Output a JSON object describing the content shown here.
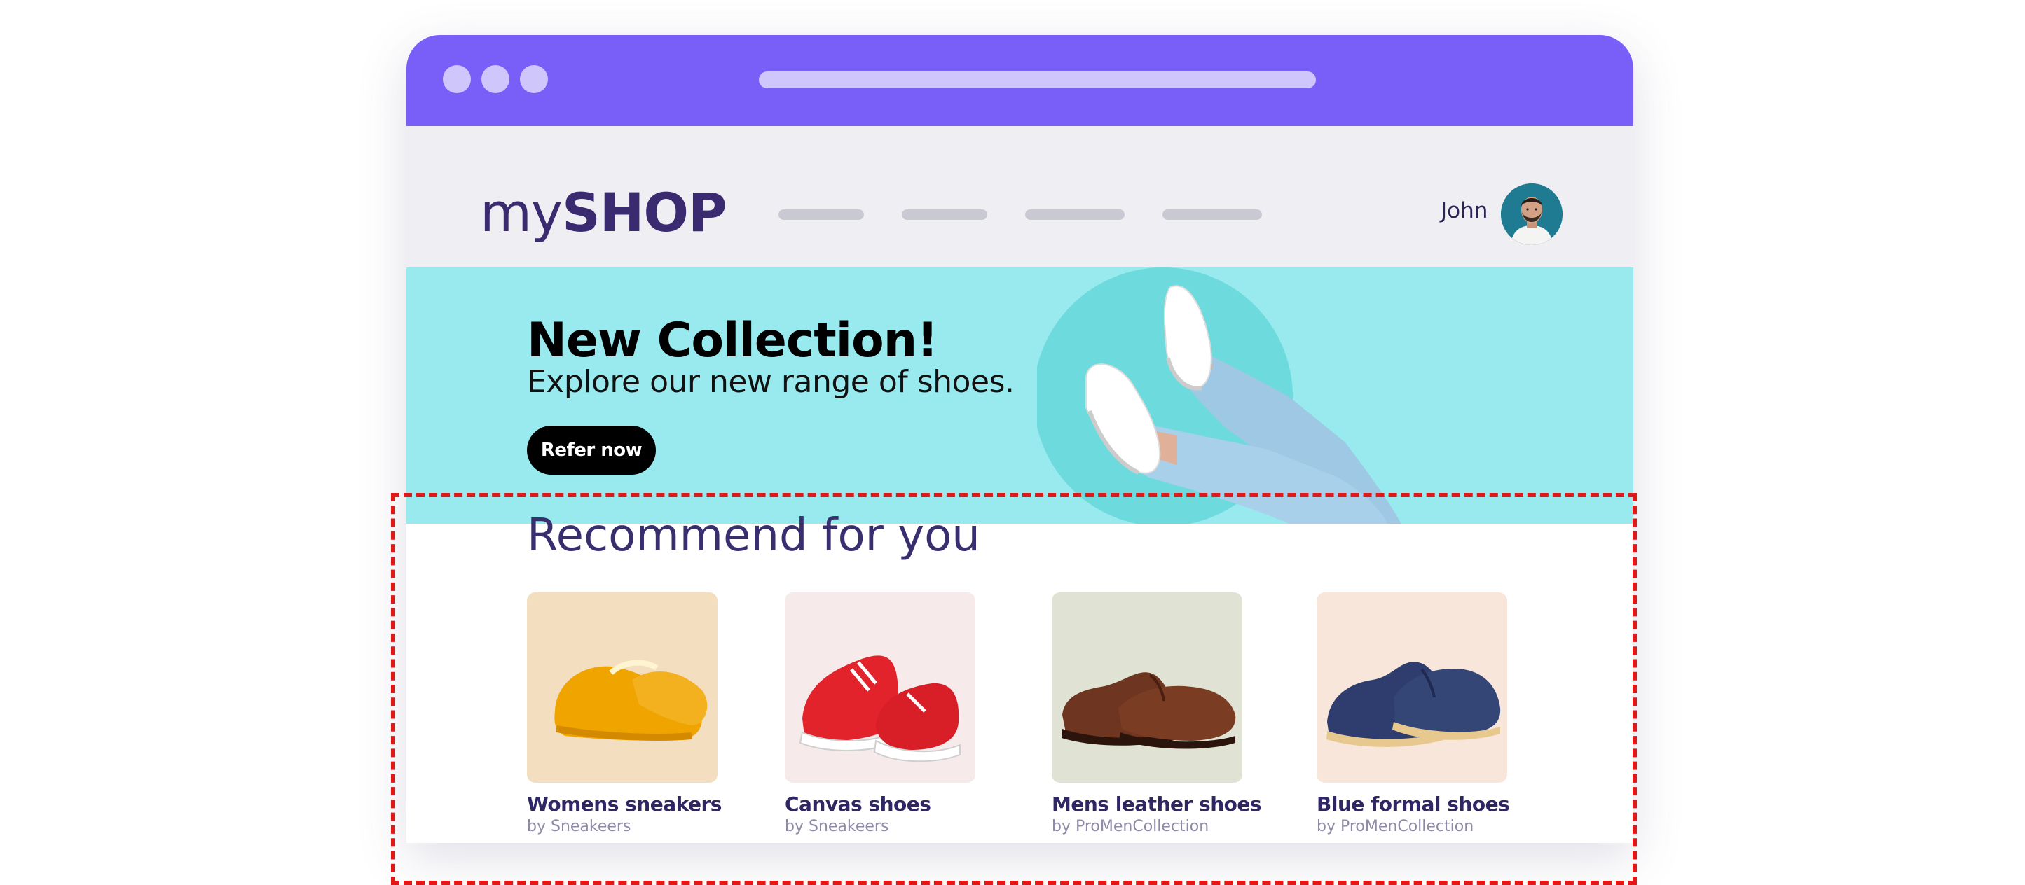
{
  "colors": {
    "titlebar": "#795ef8",
    "nav_bg": "#eeeef3",
    "hero_bg": "#98eaee",
    "accent_text": "#3a2a70",
    "highlight_border": "#e01818"
  },
  "browser": {
    "window_controls": [
      "dot",
      "dot",
      "dot"
    ]
  },
  "header": {
    "logo_light": "my",
    "logo_bold": "SHOP",
    "nav_links": [
      "",
      "",
      "",
      ""
    ],
    "user_name": "John",
    "avatar_icon": "user-avatar"
  },
  "hero": {
    "title": "New Collection!",
    "subtitle": "Explore our new range of shoes.",
    "button_label": "Refer now"
  },
  "recommendations": {
    "title": "Recommend for you",
    "products": [
      {
        "name": "Womens sneakers",
        "by": "by Sneakeers",
        "bg": "#f3dfbf",
        "icon": "yellow-sneakers"
      },
      {
        "name": "Canvas shoes",
        "by": "by Sneakeers",
        "bg": "#f7eaea",
        "icon": "red-canvas-shoes"
      },
      {
        "name": "Mens leather shoes",
        "by": "by ProMenCollection",
        "bg": "#e0e3d3",
        "icon": "brown-leather-shoes"
      },
      {
        "name": "Blue formal shoes",
        "by": "by ProMenCollection",
        "bg": "#f8e6da",
        "icon": "blue-formal-shoes"
      }
    ]
  }
}
